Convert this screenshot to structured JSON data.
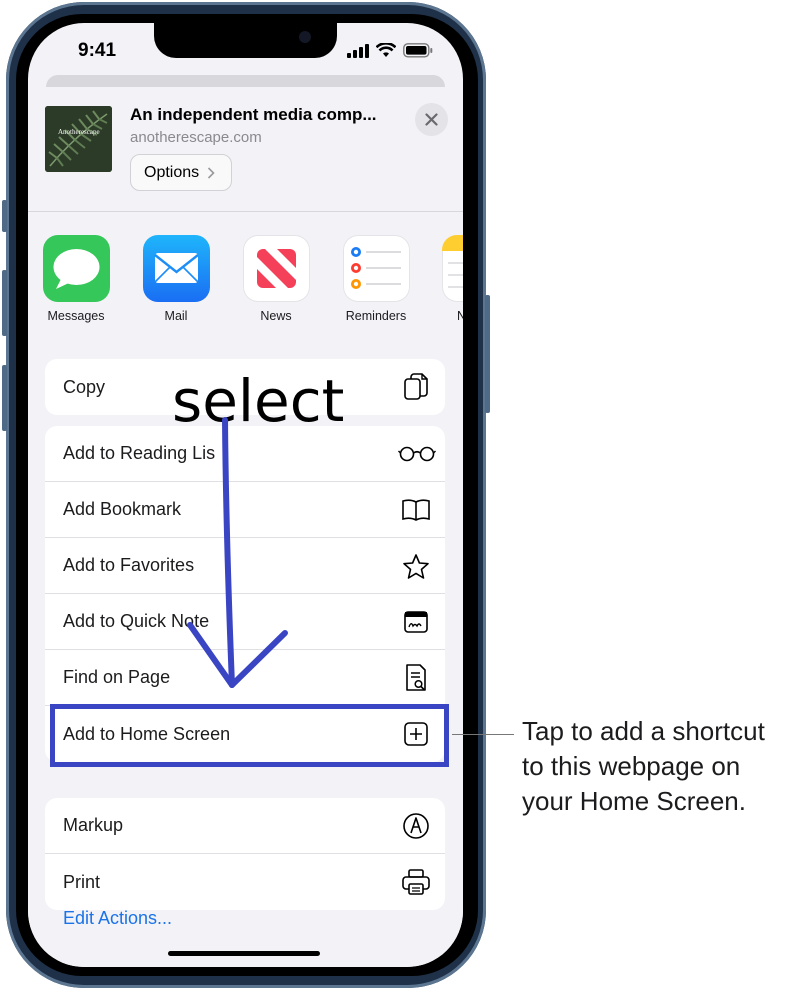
{
  "status_bar": {
    "time": "9:41"
  },
  "share_header": {
    "thumbnail_text": "Anotherescape",
    "title": "An independent media comp...",
    "url": "anotherescape.com",
    "options_label": "Options"
  },
  "apps": [
    {
      "label": "Messages",
      "icon": "messages-icon",
      "color": "#35c759"
    },
    {
      "label": "Mail",
      "icon": "mail-icon",
      "color": "#2a8cf7"
    },
    {
      "label": "News",
      "icon": "news-icon",
      "color": "#f5405a"
    },
    {
      "label": "Reminders",
      "icon": "reminders-icon",
      "color": "#ffffff"
    },
    {
      "label": "N",
      "icon": "notes-icon",
      "color": "#fecd2f"
    }
  ],
  "actions": {
    "copy": {
      "label": "Copy",
      "icon": "copy-icon"
    },
    "reading_list": {
      "label": "Add to Reading Lis",
      "icon": "glasses-icon"
    },
    "bookmark": {
      "label": "Add Bookmark",
      "icon": "book-icon"
    },
    "favorites": {
      "label": "Add to Favorites",
      "icon": "star-icon"
    },
    "quick_note": {
      "label": "Add to Quick Note",
      "icon": "quick-note-icon"
    },
    "find": {
      "label": "Find on Page",
      "icon": "find-doc-icon"
    },
    "home_screen": {
      "label": "Add to Home Screen",
      "icon": "plus-square-icon"
    },
    "markup": {
      "label": "Markup",
      "icon": "markup-pen-icon"
    },
    "print": {
      "label": "Print",
      "icon": "printer-icon"
    }
  },
  "edit_actions_label": "Edit Actions...",
  "annotation": {
    "select_text": "select",
    "callout_lines": [
      "Tap to add a shortcut",
      "to this webpage on",
      "your Home Screen."
    ],
    "highlight_color": "#3a45c4"
  }
}
